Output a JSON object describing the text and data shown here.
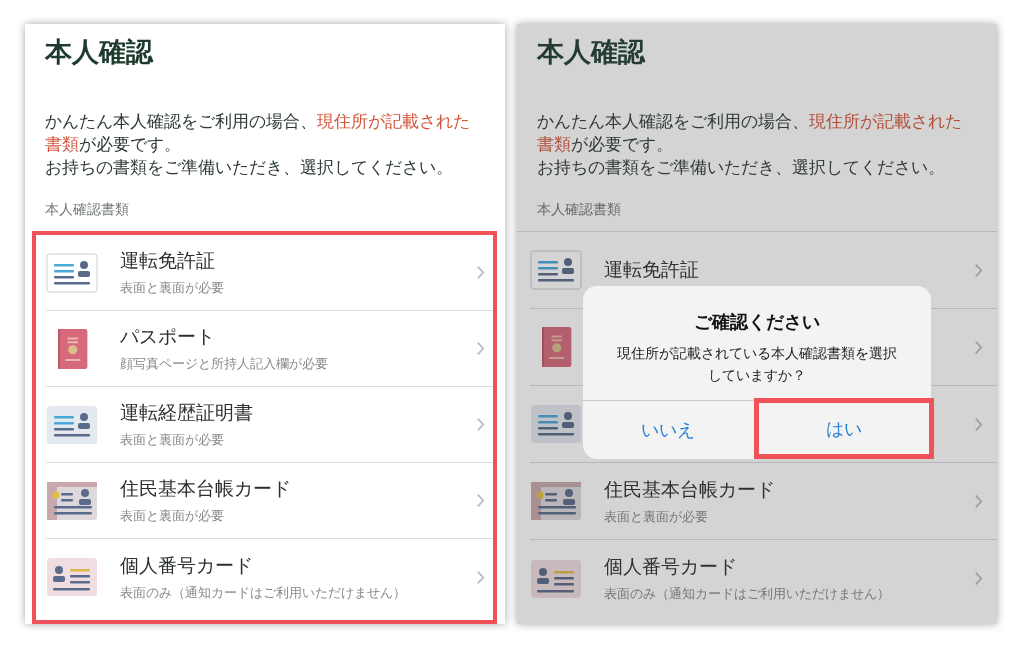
{
  "panels": [
    {
      "title": "本人確認",
      "intro": [
        [
          {
            "text": "かんたん本人確認をご利用の場合、",
            "highlight": false
          },
          {
            "text": "現住所が記載された書類",
            "highlight": true
          },
          {
            "text": "が必要です。",
            "highlight": false
          }
        ],
        [
          {
            "text": "お持ちの書類をご準備いただき、選択してください。",
            "highlight": false
          }
        ]
      ],
      "section_label": "本人確認書類",
      "dimmed": false,
      "list_outlined": true,
      "documents": [
        {
          "kind": "license",
          "name": "運転免許証",
          "note": "表面と裏面が必要"
        },
        {
          "kind": "passport",
          "name": "パスポート",
          "note": "顔写真ページと所持人記入欄が必要"
        },
        {
          "kind": "history",
          "name": "運転経歴証明書",
          "note": "表面と裏面が必要"
        },
        {
          "kind": "resident",
          "name": "住民基本台帳カード",
          "note": "表面と裏面が必要"
        },
        {
          "kind": "mynumber",
          "name": "個人番号カード",
          "note": "表面のみ（通知カードはご利用いただけません）"
        }
      ]
    },
    {
      "title": "本人確認",
      "intro": [
        [
          {
            "text": "かんたん本人確認をご利用の場合、",
            "highlight": false
          },
          {
            "text": "現住所が記載された書類",
            "highlight": true
          },
          {
            "text": "が必要です。",
            "highlight": false
          }
        ],
        [
          {
            "text": "お持ちの書類をご準備いただき、選択してください。",
            "highlight": false
          }
        ]
      ],
      "section_label": "本人確認書類",
      "dimmed": true,
      "list_outlined": false,
      "documents": [
        {
          "kind": "license",
          "name": "運転免許証"
        },
        {
          "kind": "passport"
        },
        {
          "kind": "history"
        },
        {
          "kind": "resident",
          "name": "住民基本台帳カード",
          "note": "表面と裏面が必要"
        },
        {
          "kind": "mynumber",
          "name": "個人番号カード",
          "note": "表面のみ（通知カードはご利用いただけません）"
        }
      ],
      "dialog": {
        "title": "ご確認ください",
        "message": "現住所が記載されている本人確認書類を選択していますか？",
        "buttons": [
          {
            "label": "いいえ",
            "outlined": false
          },
          {
            "label": "はい",
            "outlined": true
          }
        ]
      }
    }
  ]
}
